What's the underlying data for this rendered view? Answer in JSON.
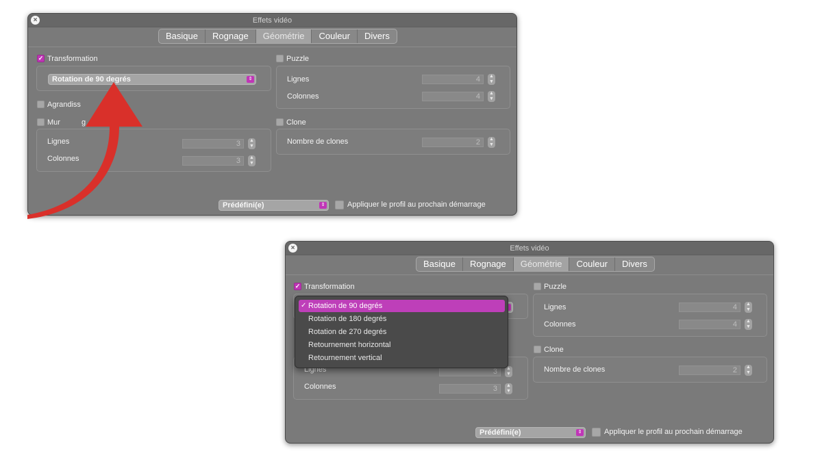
{
  "window": {
    "title": "Effets vidéo"
  },
  "tabs": [
    "Basique",
    "Rognage",
    "Géométrie",
    "Couleur",
    "Divers"
  ],
  "active_tab": "Géométrie",
  "transformation": {
    "label": "Transformation",
    "checked": true,
    "selected": "Rotation de 90 degrés"
  },
  "agrandissement": {
    "label_partial": "Agrandiss"
  },
  "mur": {
    "label_partial": "Mur",
    "label_tail": "g",
    "lines_label": "Lignes",
    "lines_value": "3",
    "columns_label": "Colonnes",
    "columns_value": "3"
  },
  "puzzle": {
    "label": "Puzzle",
    "lines_label": "Lignes",
    "lines_value": "4",
    "columns_label": "Colonnes",
    "columns_value": "4"
  },
  "clone": {
    "label": "Clone",
    "count_label": "Nombre de clones",
    "count_value": "2"
  },
  "preset": {
    "label": "Prédéfini(e)"
  },
  "apply_profile": {
    "label": "Appliquer le profil au prochain démarrage"
  },
  "dropdown": {
    "items": [
      {
        "label": "Rotation de 90 degrés",
        "selected": true
      },
      {
        "label": "Rotation de 180 degrés",
        "selected": false
      },
      {
        "label": "Rotation de 270 degrés",
        "selected": false
      },
      {
        "label": "Retournement horizontal",
        "selected": false
      },
      {
        "label": "Retournement vertical",
        "selected": false
      }
    ],
    "check_glyph": "✓"
  },
  "colors": {
    "accent": "#be3fb9",
    "arrow": "#d9302a",
    "window_bg": "#7a7a7a",
    "menu_bg": "#4a4a4a"
  },
  "icons": {
    "close": "close-icon",
    "popup": "updown-chevron-icon",
    "stepper": "stepper-icon",
    "checkmark": "checkmark-icon",
    "arrow": "curved-arrow-icon"
  }
}
